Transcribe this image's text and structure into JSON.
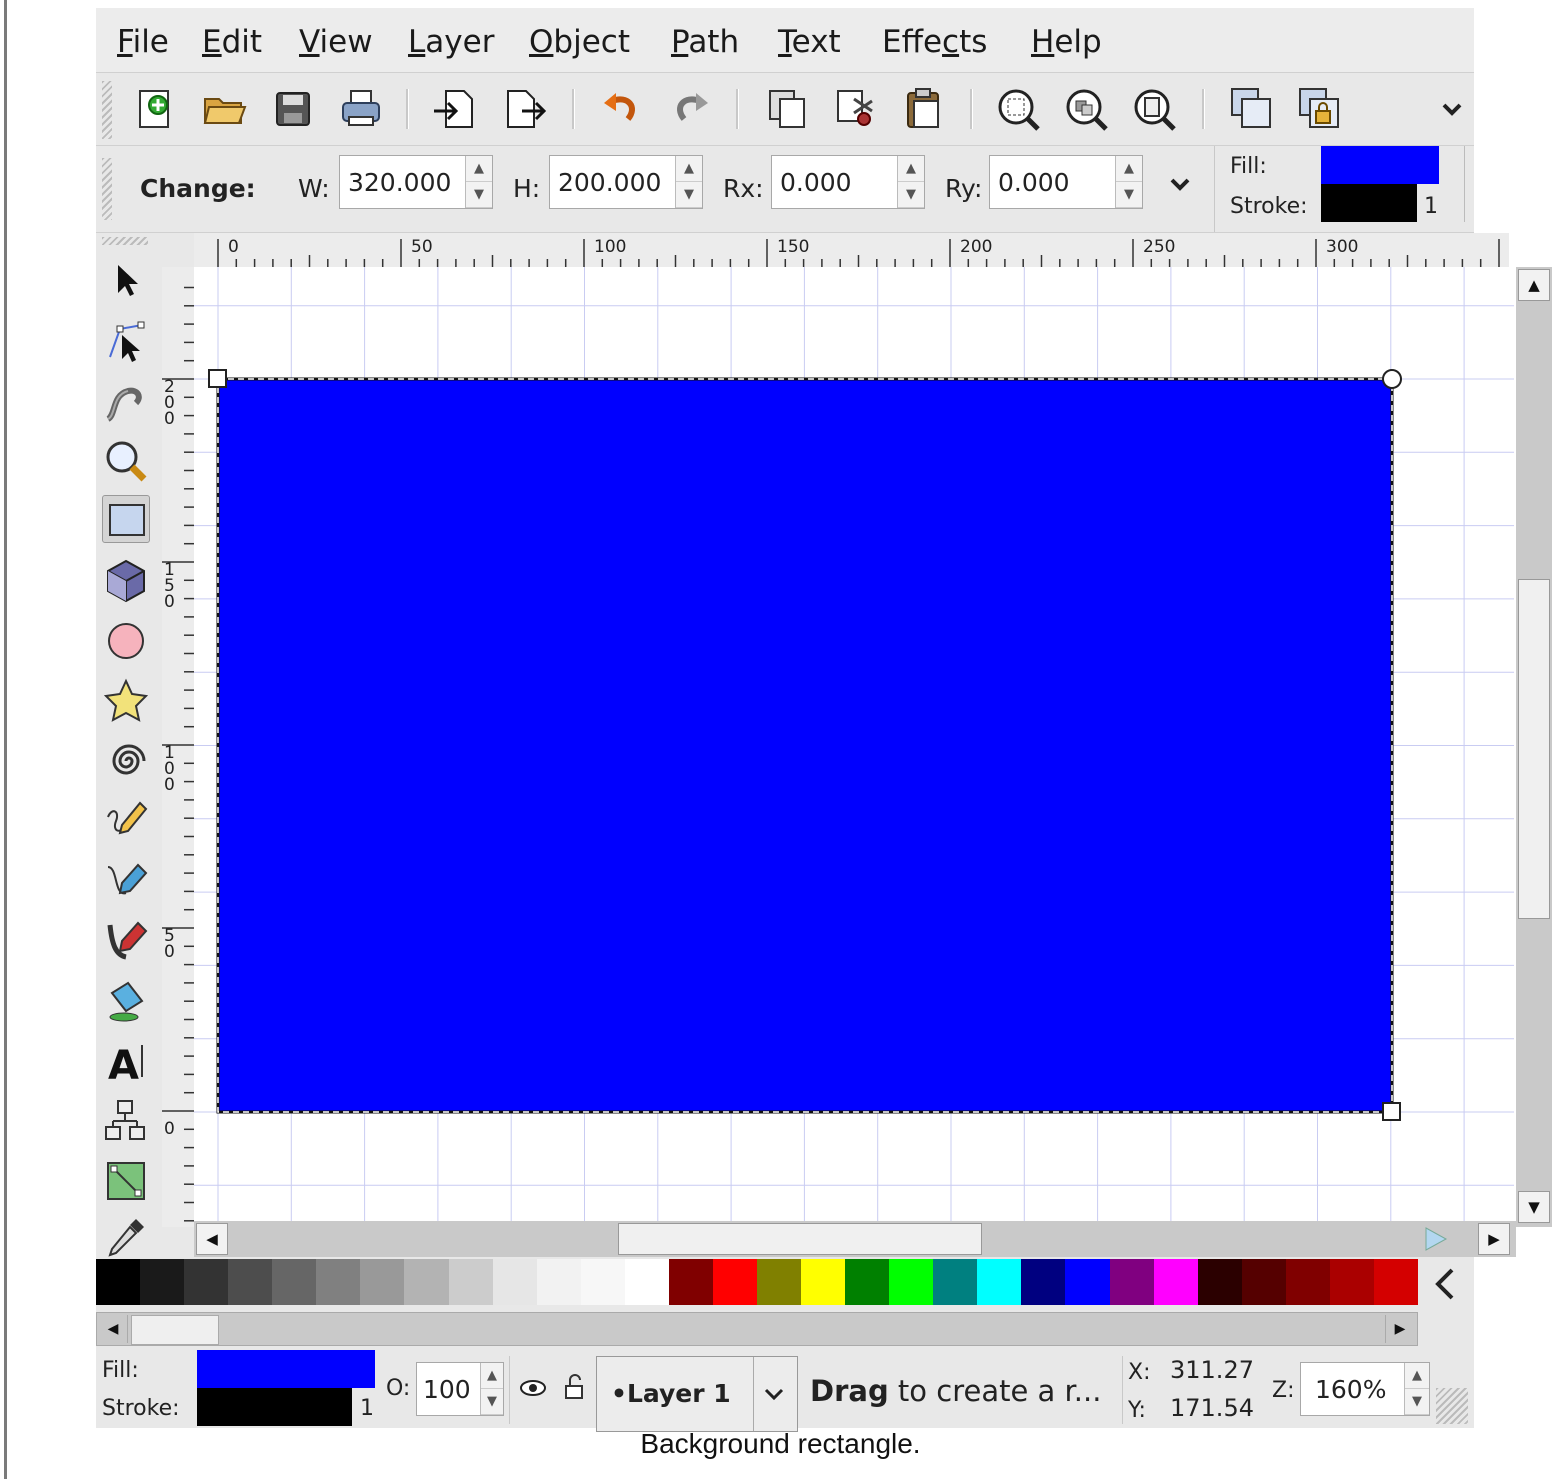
{
  "menu": [
    "File",
    "Edit",
    "View",
    "Layer",
    "Object",
    "Path",
    "Text",
    "Effects",
    "Help"
  ],
  "menu_mnemonics": [
    "F",
    "E",
    "V",
    "L",
    "O",
    "P",
    "T",
    "c",
    "H"
  ],
  "toolbar_icons": [
    "new-document-icon",
    "open-icon",
    "save-icon",
    "print-icon",
    "import-icon",
    "export-icon",
    "undo-icon",
    "redo-icon",
    "duplicate-icon",
    "cut-icon",
    "paste-icon",
    "zoom-selection-icon",
    "zoom-drawing-icon",
    "zoom-page-icon",
    "group-icon",
    "lock-icon",
    "more-chevron-icon"
  ],
  "controls": {
    "change_label": "Change:",
    "w_label": "W:",
    "w_value": "320.000",
    "h_label": "H:",
    "h_value": "200.000",
    "rx_label": "Rx:",
    "rx_value": "0.000",
    "ry_label": "Ry:",
    "ry_value": "0.000",
    "fill_label": "Fill:",
    "stroke_label": "Stroke:",
    "stroke_width": "1",
    "fill_color": "#0000ff",
    "stroke_color": "#000000"
  },
  "tools": [
    "selector-icon",
    "node-icon",
    "tweak-icon",
    "zoom-icon",
    "rectangle-icon",
    "3dbox-icon",
    "ellipse-icon",
    "star-icon",
    "spiral-icon",
    "pencil-icon",
    "pen-icon",
    "calligraphy-icon",
    "paint-bucket-icon",
    "text-icon",
    "connector-icon",
    "gradient-icon",
    "dropper-icon"
  ],
  "ruler_top": [
    "0",
    "50",
    "100",
    "150",
    "200",
    "250",
    "300"
  ],
  "ruler_left": [
    "200",
    "150",
    "100",
    "50",
    "0"
  ],
  "rectangle_fill": "#0000ff",
  "palette": [
    "#000000",
    "#1a1a1a",
    "#333333",
    "#4d4d4d",
    "#666666",
    "#808080",
    "#999999",
    "#b3b3b3",
    "#cccccc",
    "#e6e6e6",
    "#f2f2f2",
    "#f7f7f7",
    "#ffffff",
    "#800000",
    "#ff0000",
    "#808000",
    "#ffff00",
    "#008000",
    "#00ff00",
    "#008080",
    "#00ffff",
    "#000080",
    "#0000ff",
    "#800080",
    "#ff00ff",
    "#2b0000",
    "#550000",
    "#800000",
    "#aa0000",
    "#d40000"
  ],
  "status": {
    "fill_label": "Fill:",
    "stroke_label": "Stroke:",
    "stroke_width": "1",
    "opacity_label": "O:",
    "opacity_value": "100",
    "layer_name": "•Layer 1",
    "message_bold": "Drag",
    "message_rest": " to create a r...",
    "x_label": "X:",
    "x_value": "311.27",
    "y_label": "Y:",
    "y_value": "171.54",
    "zoom_label": "Z:",
    "zoom_value": "160%"
  },
  "caption": "Background rectangle."
}
